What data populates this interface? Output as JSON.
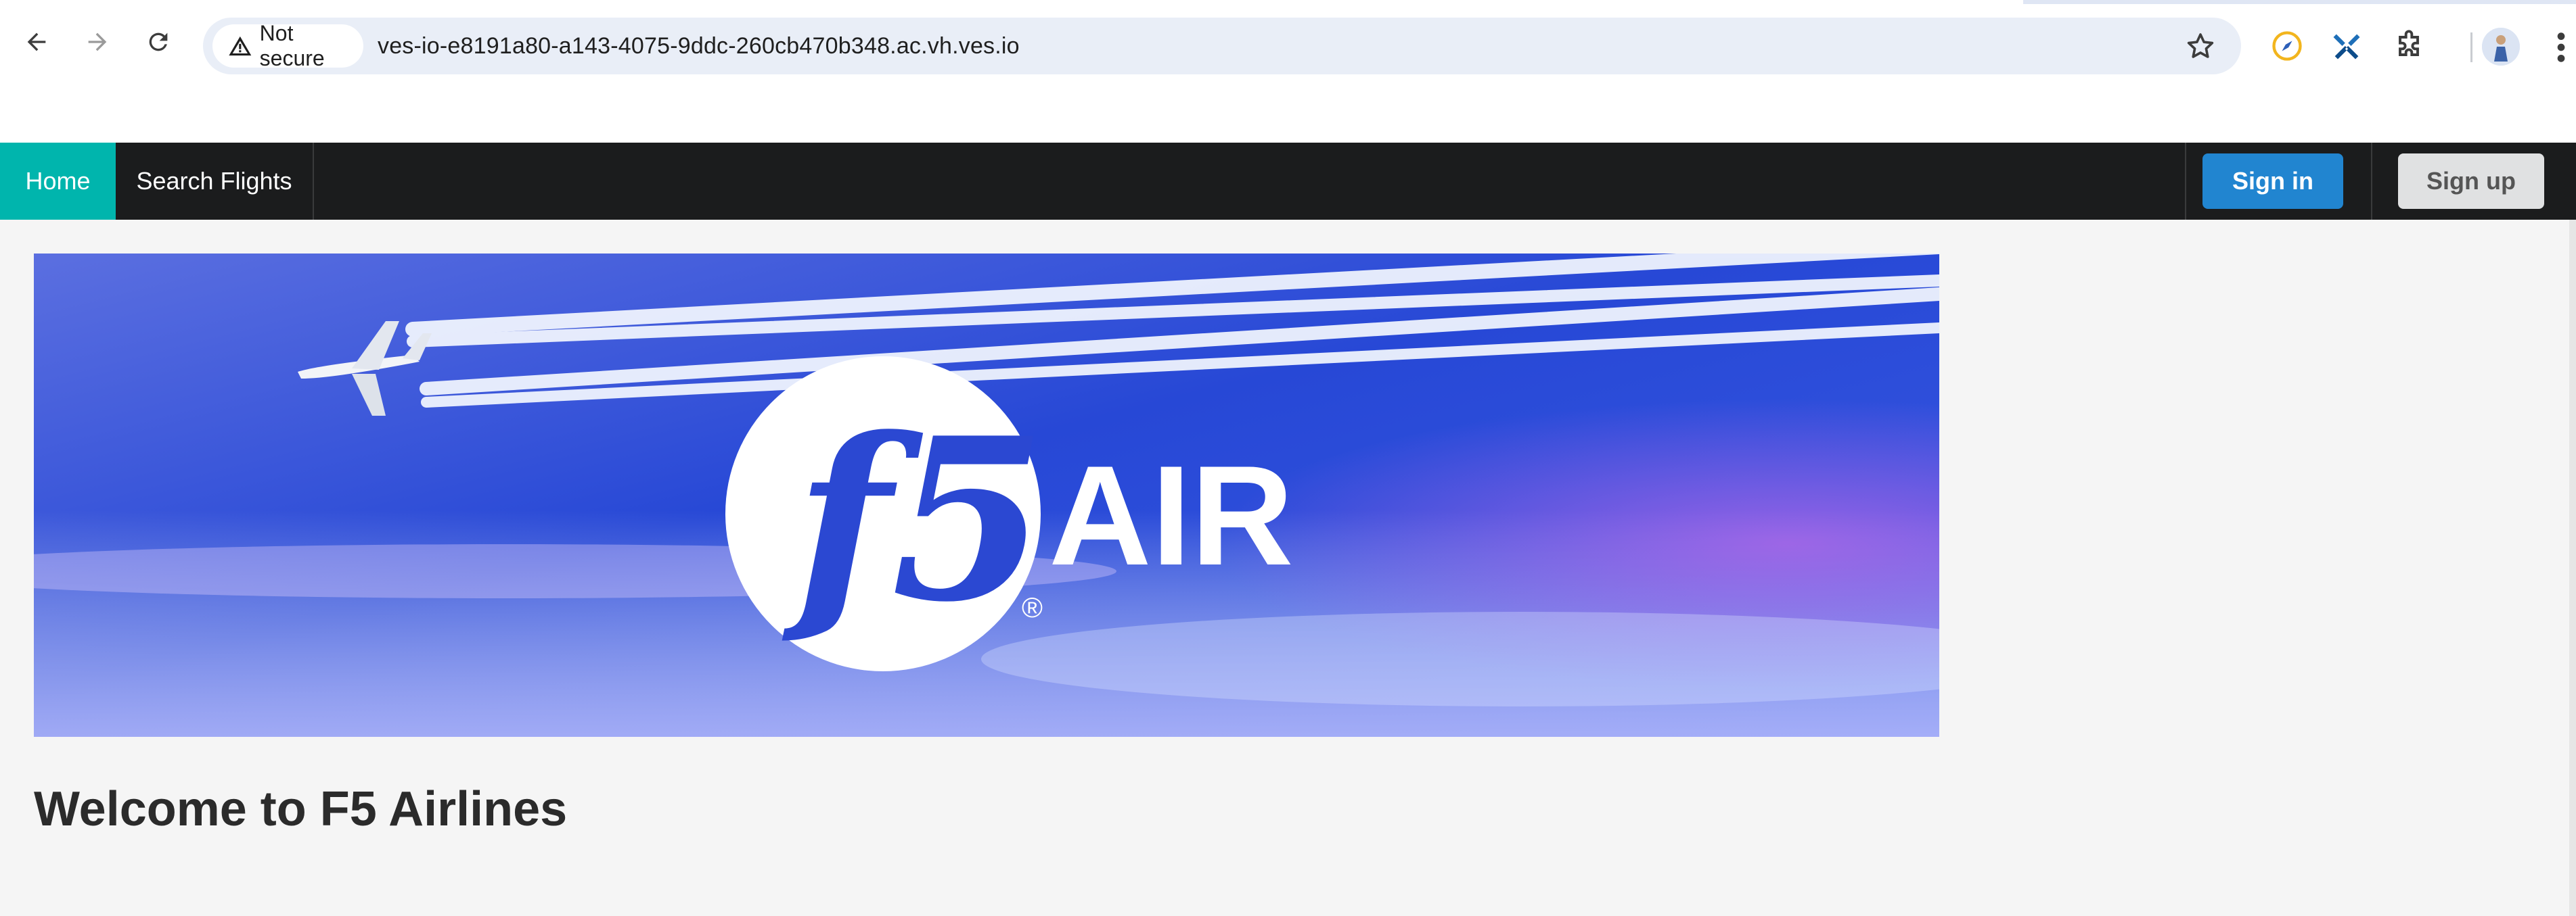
{
  "browser": {
    "security_label": "Not secure",
    "url": "ves-io-e8191a80-a143-4075-9ddc-260cb470b348.ac.vh.ves.io",
    "icons": [
      "back-icon",
      "forward-icon",
      "reload-icon",
      "warning-icon",
      "bookmark-star-icon",
      "extension-compass-icon",
      "extension-tools-icon",
      "extensions-puzzle-icon",
      "profile-avatar",
      "more-menu-icon"
    ]
  },
  "navbar": {
    "items": [
      {
        "label": "Home",
        "active": true
      },
      {
        "label": "Search Flights",
        "active": false
      }
    ],
    "sign_in_label": "Sign in",
    "sign_up_label": "Sign up",
    "colors": {
      "active": "#00b5ad",
      "bar": "#1b1c1d",
      "sign_in": "#2185d0",
      "sign_up": "#e0e1e2"
    }
  },
  "banner": {
    "logo_text": "f5",
    "brand_text": "AIR",
    "registered_mark": "®"
  },
  "main": {
    "heading": "Welcome to F5 Airlines"
  }
}
